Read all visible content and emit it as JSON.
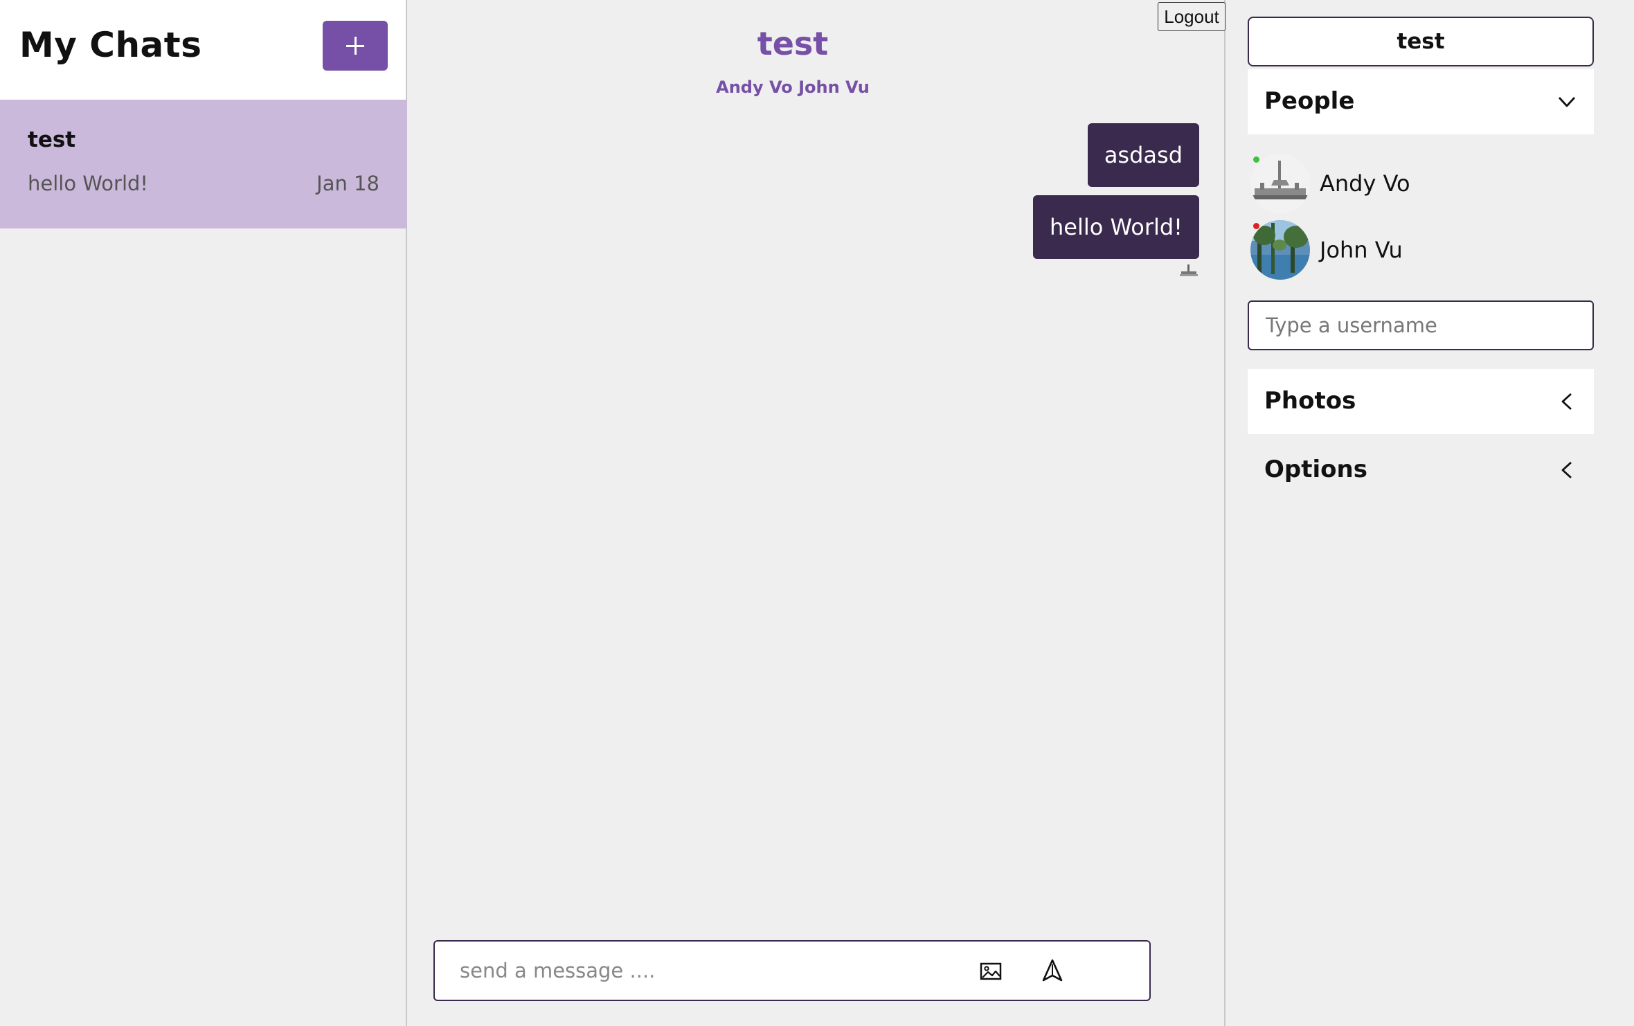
{
  "sidebar": {
    "title": "My Chats",
    "new_chat_icon": "plus-icon",
    "chats": [
      {
        "title": "test",
        "preview": "hello World!",
        "date": "Jan 18"
      }
    ]
  },
  "main": {
    "logout_label": "Logout",
    "chat_title": "test",
    "members": "Andy Vo John Vu",
    "messages": [
      {
        "text": "asdasd"
      },
      {
        "text": "hello World!"
      }
    ],
    "composer": {
      "placeholder": "send a message ....",
      "image_icon": "image-icon",
      "send_icon": "send-icon"
    }
  },
  "right_panel": {
    "chat_name": "test",
    "people_title": "People",
    "people": [
      {
        "name": "Andy Vo",
        "status": "online",
        "status_color": "#3cc23c"
      },
      {
        "name": "John Vu",
        "status": "offline",
        "status_color": "#e02020"
      }
    ],
    "username_placeholder": "Type a username",
    "photos_title": "Photos",
    "options_title": "Options"
  },
  "colors": {
    "accent": "#7550a6",
    "selected_chat": "#cbb9dc",
    "bubble": "#3a2a4d",
    "background": "#efefef"
  }
}
